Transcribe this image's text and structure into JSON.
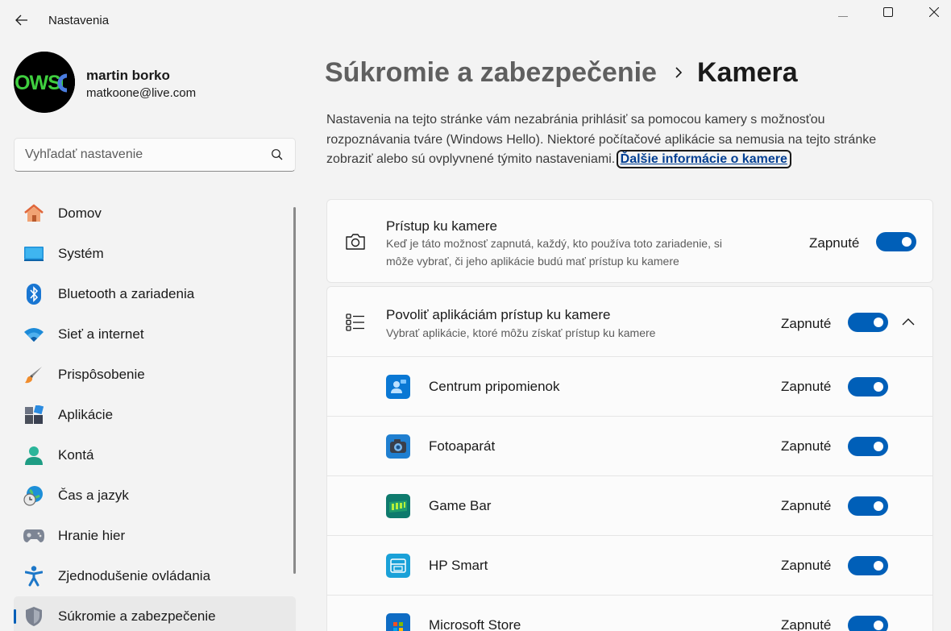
{
  "window": {
    "title": "Nastavenia"
  },
  "profile": {
    "name": "martin borko",
    "email": "matkoone@live.com",
    "avatar_text": "OWSC"
  },
  "search": {
    "placeholder": "Vyhľadať nastavenie"
  },
  "sidebar": {
    "items": [
      {
        "label": "Domov",
        "icon": "home-icon"
      },
      {
        "label": "Systém",
        "icon": "system-icon"
      },
      {
        "label": "Bluetooth a zariadenia",
        "icon": "bluetooth-icon"
      },
      {
        "label": "Sieť a internet",
        "icon": "wifi-icon"
      },
      {
        "label": "Prispôsobenie",
        "icon": "brush-icon"
      },
      {
        "label": "Aplikácie",
        "icon": "apps-icon"
      },
      {
        "label": "Kontá",
        "icon": "account-icon"
      },
      {
        "label": "Čas a jazyk",
        "icon": "globe-clock-icon"
      },
      {
        "label": "Hranie hier",
        "icon": "gamepad-icon"
      },
      {
        "label": "Zjednodušenie ovládania",
        "icon": "accessibility-icon"
      },
      {
        "label": "Súkromie a zabezpečenie",
        "icon": "shield-icon"
      }
    ],
    "active_index": 10
  },
  "header": {
    "parent": "Súkromie a zabezpečenie",
    "current": "Kamera"
  },
  "description": {
    "text": "Nastavenia na tejto stránke vám nezabránia prihlásiť sa pomocou kamery s možnosťou rozpoznávania tváre (Windows Hello). Niektoré počítačové aplikácie sa nemusia na tejto stránke zobraziť alebo sú ovplyvnené týmito nastaveniami. ",
    "link": "Ďalšie informácie o kamere"
  },
  "camera_access": {
    "title": "Prístup ku kamere",
    "subtitle_line1": "Keď je táto možnosť zapnutá, každý, kto používa toto zariadenie, si",
    "subtitle_line2": "môže vybrať, či jeho aplikácie budú mať prístup ku kamere",
    "state": "Zapnuté",
    "on": true
  },
  "app_access": {
    "title": "Povoliť aplikáciám prístup ku kamere",
    "subtitle": "Vybrať aplikácie, ktoré môžu získať prístup ku kamere",
    "state": "Zapnuté",
    "on": true,
    "expanded": true
  },
  "apps": [
    {
      "name": "Centrum pripomienok",
      "state": "Zapnuté",
      "icon": "feedback-hub-icon",
      "color": "#0a78d4"
    },
    {
      "name": "Fotoaparát",
      "state": "Zapnuté",
      "icon": "camera-app-icon",
      "color": "#1f7fd0"
    },
    {
      "name": "Game Bar",
      "state": "Zapnuté",
      "icon": "game-bar-icon",
      "color": "#0e7a6d"
    },
    {
      "name": "HP Smart",
      "state": "Zapnuté",
      "icon": "hp-smart-icon",
      "color": "#1aa1d8"
    },
    {
      "name": "Microsoft Store",
      "state": "Zapnuté",
      "icon": "store-icon",
      "color": "#0e6cc4"
    }
  ],
  "colors": {
    "accent": "#005fb8",
    "background": "#f3f3f3",
    "card": "#fbfbfb"
  }
}
